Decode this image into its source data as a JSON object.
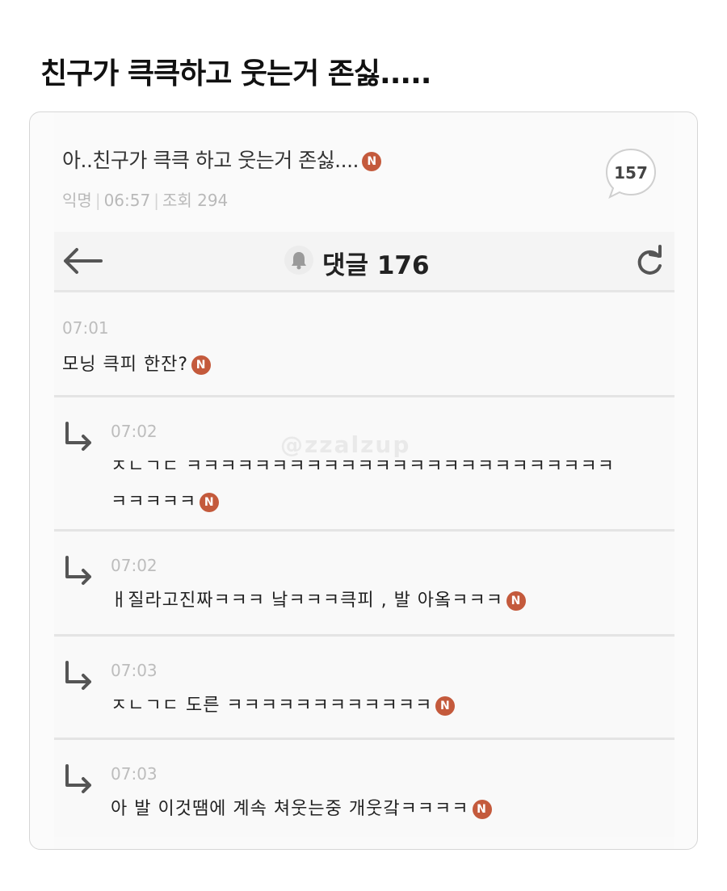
{
  "page_title": "친구가 큭큭하고 웃는거 존싫.....",
  "post": {
    "title": "아..친구가 큭큭 하고 웃는거 존싫....",
    "badge": "N",
    "author": "익명",
    "time": "06:57",
    "views": "조회 294",
    "comment_count": "157"
  },
  "nav": {
    "title": "댓글 176"
  },
  "watermark": "@zzalzup",
  "comments": [
    {
      "time": "07:01",
      "lines": [
        "모닝 큭피 한잔?"
      ],
      "badge": "N"
    },
    {
      "time": "07:02",
      "lines": [
        "ㅈㄴㄱㄷ ㅋㅋㅋㅋㅋㅋㅋㅋㅋㅋㅋㅋㅋㅋㅋㅋㅋㅋㅋㅋㅋㅋㅋㅋㅋ",
        "ㅋㅋㅋㅋㅋ"
      ],
      "badge": "N"
    },
    {
      "time": "07:02",
      "lines": [
        "ㅐ질라고진짜ㅋㅋㅋ  낰ㅋㅋㅋ큭피 ,  발 아옼ㅋㅋㅋ"
      ],
      "badge": "N"
    },
    {
      "time": "07:03",
      "lines": [
        "ㅈㄴㄱㄷ 도른 ㅋㅋㅋㅋㅋㅋㅋㅋㅋㅋㅋㅋ"
      ],
      "badge": "N"
    },
    {
      "time": "07:03",
      "lines": [
        "아  발 이것땜에 계속 쳐웃는중 개웃갘ㅋㅋㅋㅋ"
      ],
      "badge": "N"
    }
  ],
  "colors": {
    "badge": "#c45a3c",
    "meta": "#b9b9b9"
  },
  "icons": [
    "back-arrow-icon",
    "bell-icon",
    "refresh-icon",
    "reply-arrow-icon",
    "speech-bubble-icon"
  ]
}
